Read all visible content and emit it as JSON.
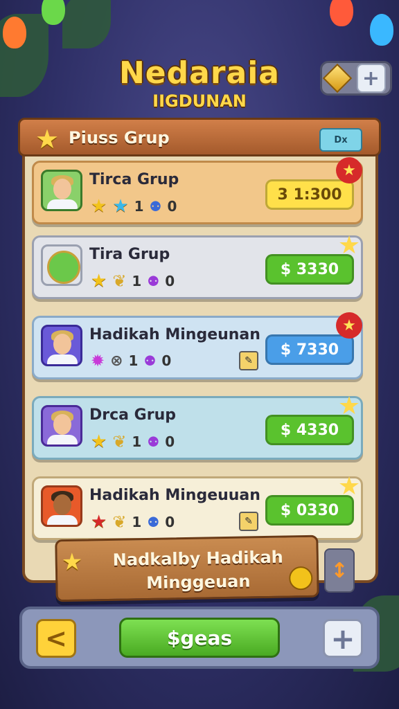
{
  "header": {
    "title": "Nedaraia",
    "subtitle": "IIGDUNAN",
    "plus_label": "+"
  },
  "panel": {
    "title": "Piuss Grup",
    "ok_label": "Dx"
  },
  "colors": {
    "accent_gold": "#ffd84a",
    "wood": "#a45a2c",
    "green_btn": "#5ac22e",
    "blue_btn": "#4a9ee8",
    "yellow_btn": "#ffd23a",
    "badge_red": "#d62a2a"
  },
  "rows": [
    {
      "name": "Tirca Grup",
      "count": "1",
      "count2": "0",
      "price": "3 1:300",
      "badge_icon": "star-icon"
    },
    {
      "name": "Tira Grup",
      "count": "1",
      "count2": "0",
      "price": "$ 3330",
      "badge_icon": "star-icon"
    },
    {
      "name": "Hadikah Mingeunan",
      "count": "1",
      "count2": "0",
      "price": "$ 7330",
      "badge_icon": "star-icon"
    },
    {
      "name": "Drca Grup",
      "count": "1",
      "count2": "0",
      "price": "$ 4330",
      "badge_icon": "star-icon"
    },
    {
      "name": "Hadikah Mingeuuan",
      "count": "1",
      "count2": "0",
      "price": "$ 0330",
      "badge_icon": "star-icon"
    }
  ],
  "banner": {
    "line1": "Nadkalby Hadikah",
    "line2": "Minggeuan"
  },
  "bottom": {
    "play_label": "$geas",
    "add_label": "+",
    "back_label": "<"
  }
}
